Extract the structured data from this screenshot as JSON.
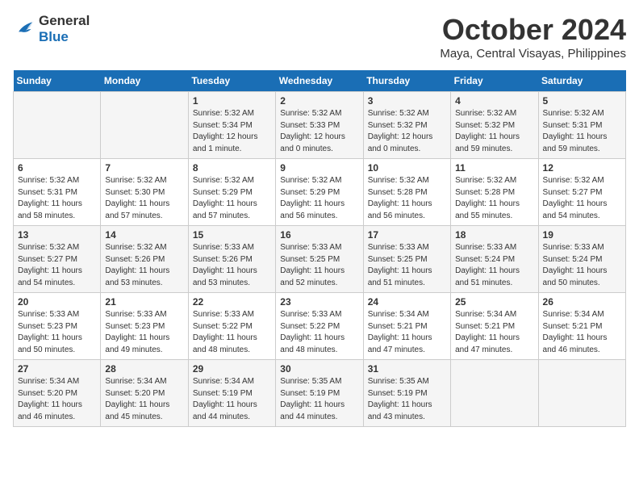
{
  "header": {
    "logo_line1": "General",
    "logo_line2": "Blue",
    "month": "October 2024",
    "location": "Maya, Central Visayas, Philippines"
  },
  "days_of_week": [
    "Sunday",
    "Monday",
    "Tuesday",
    "Wednesday",
    "Thursday",
    "Friday",
    "Saturday"
  ],
  "weeks": [
    [
      {
        "day": "",
        "info": ""
      },
      {
        "day": "",
        "info": ""
      },
      {
        "day": "1",
        "info": "Sunrise: 5:32 AM\nSunset: 5:34 PM\nDaylight: 12 hours\nand 1 minute."
      },
      {
        "day": "2",
        "info": "Sunrise: 5:32 AM\nSunset: 5:33 PM\nDaylight: 12 hours\nand 0 minutes."
      },
      {
        "day": "3",
        "info": "Sunrise: 5:32 AM\nSunset: 5:32 PM\nDaylight: 12 hours\nand 0 minutes."
      },
      {
        "day": "4",
        "info": "Sunrise: 5:32 AM\nSunset: 5:32 PM\nDaylight: 11 hours\nand 59 minutes."
      },
      {
        "day": "5",
        "info": "Sunrise: 5:32 AM\nSunset: 5:31 PM\nDaylight: 11 hours\nand 59 minutes."
      }
    ],
    [
      {
        "day": "6",
        "info": "Sunrise: 5:32 AM\nSunset: 5:31 PM\nDaylight: 11 hours\nand 58 minutes."
      },
      {
        "day": "7",
        "info": "Sunrise: 5:32 AM\nSunset: 5:30 PM\nDaylight: 11 hours\nand 57 minutes."
      },
      {
        "day": "8",
        "info": "Sunrise: 5:32 AM\nSunset: 5:29 PM\nDaylight: 11 hours\nand 57 minutes."
      },
      {
        "day": "9",
        "info": "Sunrise: 5:32 AM\nSunset: 5:29 PM\nDaylight: 11 hours\nand 56 minutes."
      },
      {
        "day": "10",
        "info": "Sunrise: 5:32 AM\nSunset: 5:28 PM\nDaylight: 11 hours\nand 56 minutes."
      },
      {
        "day": "11",
        "info": "Sunrise: 5:32 AM\nSunset: 5:28 PM\nDaylight: 11 hours\nand 55 minutes."
      },
      {
        "day": "12",
        "info": "Sunrise: 5:32 AM\nSunset: 5:27 PM\nDaylight: 11 hours\nand 54 minutes."
      }
    ],
    [
      {
        "day": "13",
        "info": "Sunrise: 5:32 AM\nSunset: 5:27 PM\nDaylight: 11 hours\nand 54 minutes."
      },
      {
        "day": "14",
        "info": "Sunrise: 5:32 AM\nSunset: 5:26 PM\nDaylight: 11 hours\nand 53 minutes."
      },
      {
        "day": "15",
        "info": "Sunrise: 5:33 AM\nSunset: 5:26 PM\nDaylight: 11 hours\nand 53 minutes."
      },
      {
        "day": "16",
        "info": "Sunrise: 5:33 AM\nSunset: 5:25 PM\nDaylight: 11 hours\nand 52 minutes."
      },
      {
        "day": "17",
        "info": "Sunrise: 5:33 AM\nSunset: 5:25 PM\nDaylight: 11 hours\nand 51 minutes."
      },
      {
        "day": "18",
        "info": "Sunrise: 5:33 AM\nSunset: 5:24 PM\nDaylight: 11 hours\nand 51 minutes."
      },
      {
        "day": "19",
        "info": "Sunrise: 5:33 AM\nSunset: 5:24 PM\nDaylight: 11 hours\nand 50 minutes."
      }
    ],
    [
      {
        "day": "20",
        "info": "Sunrise: 5:33 AM\nSunset: 5:23 PM\nDaylight: 11 hours\nand 50 minutes."
      },
      {
        "day": "21",
        "info": "Sunrise: 5:33 AM\nSunset: 5:23 PM\nDaylight: 11 hours\nand 49 minutes."
      },
      {
        "day": "22",
        "info": "Sunrise: 5:33 AM\nSunset: 5:22 PM\nDaylight: 11 hours\nand 48 minutes."
      },
      {
        "day": "23",
        "info": "Sunrise: 5:33 AM\nSunset: 5:22 PM\nDaylight: 11 hours\nand 48 minutes."
      },
      {
        "day": "24",
        "info": "Sunrise: 5:34 AM\nSunset: 5:21 PM\nDaylight: 11 hours\nand 47 minutes."
      },
      {
        "day": "25",
        "info": "Sunrise: 5:34 AM\nSunset: 5:21 PM\nDaylight: 11 hours\nand 47 minutes."
      },
      {
        "day": "26",
        "info": "Sunrise: 5:34 AM\nSunset: 5:21 PM\nDaylight: 11 hours\nand 46 minutes."
      }
    ],
    [
      {
        "day": "27",
        "info": "Sunrise: 5:34 AM\nSunset: 5:20 PM\nDaylight: 11 hours\nand 46 minutes."
      },
      {
        "day": "28",
        "info": "Sunrise: 5:34 AM\nSunset: 5:20 PM\nDaylight: 11 hours\nand 45 minutes."
      },
      {
        "day": "29",
        "info": "Sunrise: 5:34 AM\nSunset: 5:19 PM\nDaylight: 11 hours\nand 44 minutes."
      },
      {
        "day": "30",
        "info": "Sunrise: 5:35 AM\nSunset: 5:19 PM\nDaylight: 11 hours\nand 44 minutes."
      },
      {
        "day": "31",
        "info": "Sunrise: 5:35 AM\nSunset: 5:19 PM\nDaylight: 11 hours\nand 43 minutes."
      },
      {
        "day": "",
        "info": ""
      },
      {
        "day": "",
        "info": ""
      }
    ]
  ]
}
